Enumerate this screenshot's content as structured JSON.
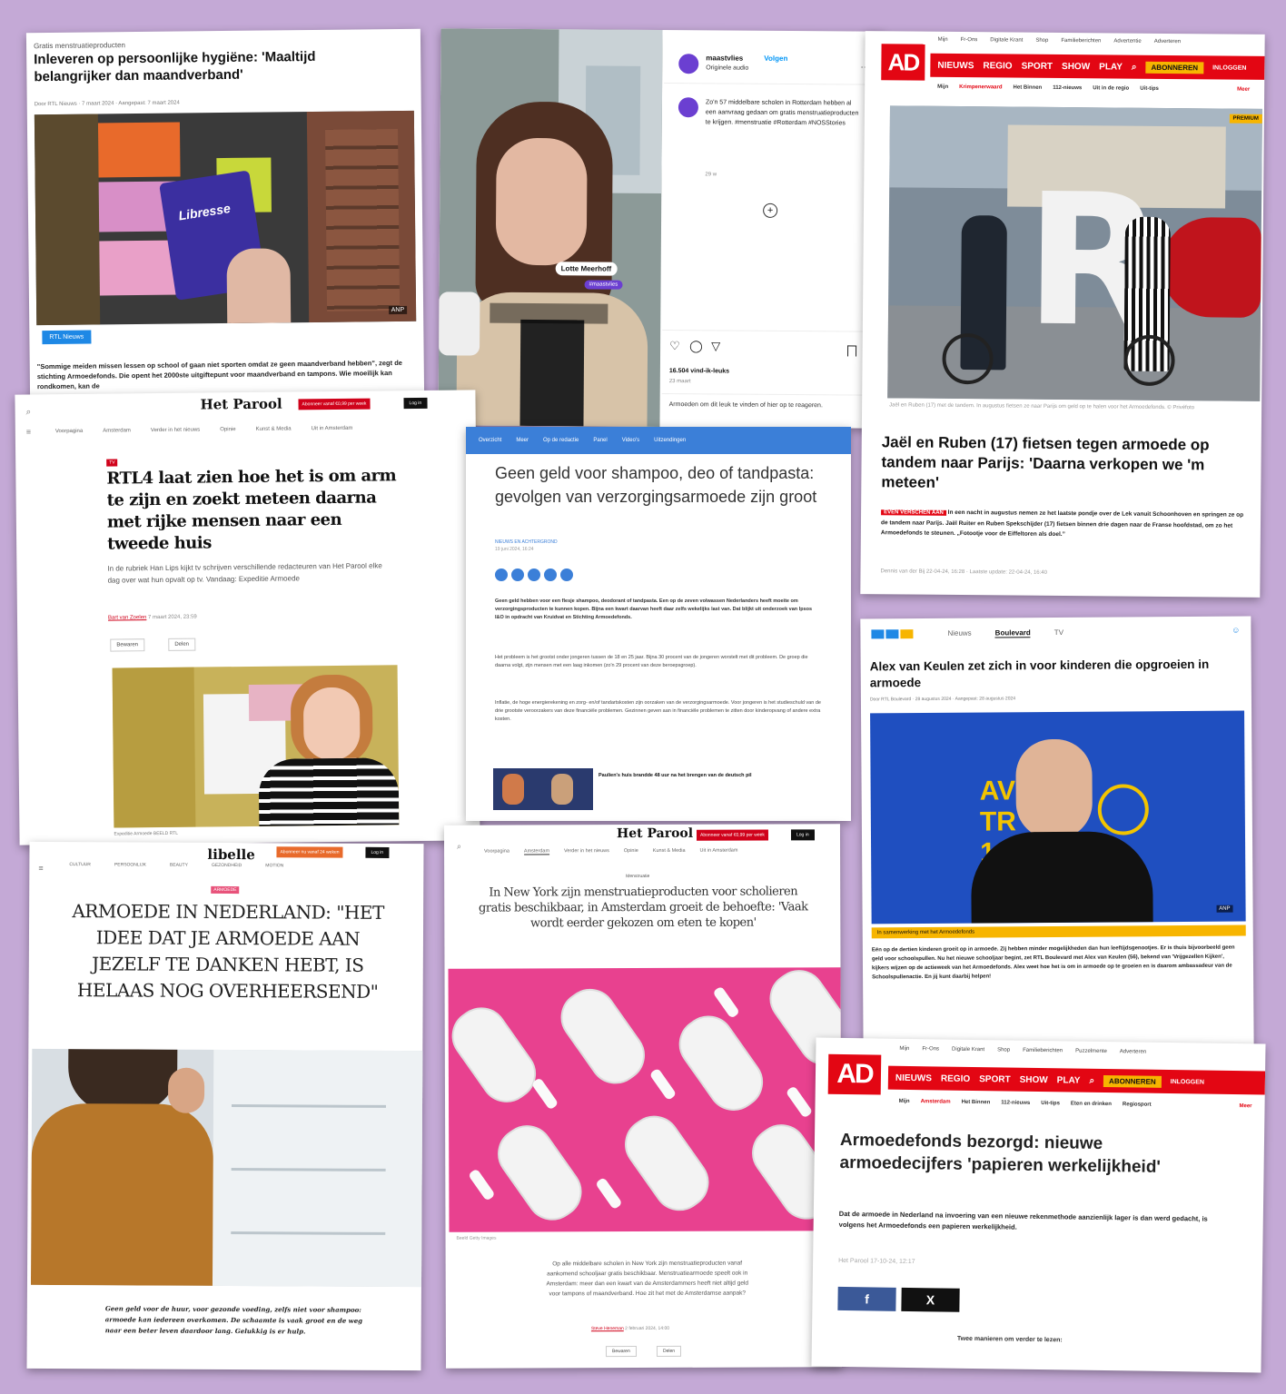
{
  "card1": {
    "kicker": "Gratis menstruatieproducten",
    "title": "Inleveren op persoonlijke hygiëne: 'Maaltijd belangrijker dan maandverband'",
    "byline": "Door RTL Nieuws · 7 maart 2024 · Aangepast: 7 maart 2024",
    "badge": "RTL Nieuws",
    "package_brand": "Libresse",
    "photo_credit": "ANP",
    "lead": "\"Sommige meiden missen lessen op school of gaan niet sporten omdat ze geen maandverband hebben\", zegt de stichting Armoedefonds. Die opent het 2000ste uitgiftepunt voor maandverband en tampons. Wie moeilijk kan rondkomen, kan de"
  },
  "card2": {
    "account": "maastvlies",
    "follow": "Volgen",
    "audio": "Originele audio",
    "caption": "Zo'n 57 middelbare scholen in Rotterdam hebben al een aanvraag gedaan om gratis menstruatieproducten te krijgen. #menstruatie #Rotterdam #NOSStories",
    "age": "29 w",
    "name_tag": "Lotte Meerhoff",
    "sub_tag": "#maastvlies",
    "likes": "16.504 vind-ik-leuks",
    "days": "23 maart",
    "reply": "Armoeden om dit leuk te vinden of hier op te reageren."
  },
  "card3": {
    "top_links": [
      "Mijn",
      "Fr-Ons",
      "Digitale Krant",
      "Shop",
      "Familieberichten",
      "Advertentie",
      "Adverteren"
    ],
    "logo": "AD",
    "nav": [
      "NIEUWS",
      "REGIO",
      "SPORT",
      "SHOW",
      "PLAY"
    ],
    "subscribe": "ABONNEREN",
    "login": "INLOGGEN",
    "subnav": [
      "Mijn",
      "Krimpenerwaard",
      "Het Binnen",
      "112-nieuws",
      "Uit in de regio",
      "Uit-tips"
    ],
    "more": "Meer",
    "premium": "PREMIUM",
    "caption": "Jaël en Ruben (17) met de tandem. In augustus fietsen ze naar Parijs om geld op te halen voor het Armoedefonds. © Privéfoto",
    "title": "Jaël en Ruben (17) fietsen tegen armoede op tandem naar Parijs: 'Daarna verkopen we 'm meteen'",
    "label": "EVEN VERSCHEN AAN",
    "lead": "In een nacht in augustus nemen ze het laatste pondje over de Lek vanuit Schoonhoven en springen ze op de tandem naar Parijs. Jaël Ruiter en Ruben Spekschijder (17) fietsen binnen drie dagen naar de Franse hoofdstad, om zo het Armoedefonds te steunen. „Fotootje voor de Eiffeltoren als doel.”",
    "meta": "Dennis van der Bij 22-04-24, 16:28 · Laatste update: 22-04-24, 16:40"
  },
  "card4": {
    "logo": "Het Parool",
    "cta": "Abonneer vanaf €0,99 per week",
    "login": "Log in",
    "nav": [
      "Voorpagina",
      "Amsterdam",
      "Verder in het nieuws",
      "Opinie",
      "Kunst & Media",
      "Uit in Amsterdam"
    ],
    "tag": "TV",
    "title": "RTL4 laat zien hoe het is om arm te zijn en zoekt meteen daarna met rijke mensen naar een tweede huis",
    "intro": "In de rubriek Han Lips kijkt tv schrijven verschillende redacteuren van Het Parool elke dag over wat hun opvalt op tv. Vandaag: Expeditie Armoede",
    "author": "Bart van Zoelen",
    "date": "7 maart 2024, 23:59",
    "save": "Bewaren",
    "share": "Delen",
    "img_caption": "Expeditie Armoede  BEELD RTL"
  },
  "card5": {
    "nav": [
      "Overzicht",
      "Meer",
      "Op de redactie",
      "Panel",
      "Video's",
      "Uitzendingen"
    ],
    "title": "Geen geld voor shampoo, deo of tandpasta: gevolgen van verzorgingsarmoede zijn groot",
    "author": "NIEUWS EN ACHTERGROND",
    "date": "19 juni 2024, 16:24",
    "p1": "Geen geld hebben voor een flesje shampoo, deodorant of tandpasta. Een op de zeven volwassen Nederlanders heeft moeite om verzorgingsproducten te kunnen kopen. Bijna een kwart daarvan heeft daar zelfs wekelijks last van. Dat blijkt uit onderzoek van Ipsos I&O in opdracht van Kruidvat en Stichting Armoedefonds.",
    "p2": "Het probleem is het grootst onder jongeren tussen de 18 en 25 jaar. Bijna 30 procent van de jongeren worstelt met dit probleem. De groep die daarna volgt, zijn mensen met een laag inkomen (zo'n 29 procent van deze beroepsgroep).",
    "p3": "Inflatie, de hoge energierekening en zorg- en/of tandartskosten zijn oorzaken van de verzorgingsarmoede. Voor jongeren is het studieschuld van de drie grootste veroorzakers van deze financiële problemen. Gezinnen geven aan in financiële problemen te zitten door kinderopvang of andere extra kosten.",
    "related": "Paulien's huis brandde 48 uur na het brengen van de deutsch pil"
  },
  "card6": {
    "tabs": [
      "Nieuws",
      "Boulevard",
      "TV"
    ],
    "title": "Alex van Keulen zet zich in voor kinderen die opgroeien in armoede",
    "byline": "Door RTL Boulevard · 28 augustus 2024 · Aangepast: 28 augustus 2024",
    "photo_credit": "ANP",
    "badge": "In samenwerking met het Armoedefonds",
    "lead": "Eén op de dertien kinderen groeit op in armoede. Zij hebben minder mogelijkheden dan hun leeftijdsgenootjes. Er is thuis bijvoorbeeld geen geld voor schoolspullen. Nu het nieuwe schooljaar begint, zet RTL Boulevard met Alex van Keulen (56), bekend van 'Vrijgezellen Kijken', kijkers wijzen op de actieweek van het Armoedefonds. Alex weet hoe het is om in armoede op te groeien en is daarom ambassadeur van de Schoolspullenactie. En jij kunt daarbij helpen!",
    "backdrop": "AV TR 10"
  },
  "card7": {
    "logo": "libelle",
    "cta": "Abonneer nu vanaf 24 weken",
    "login": "Log in",
    "nav": [
      "CULTUUR",
      "PERSOONLIJK",
      "BEAUTY",
      "GEZONDHEID",
      "MOTION"
    ],
    "tag": "ARMOEDE",
    "title": "ARMOEDE IN NEDERLAND: \"HET IDEE DAT JE ARMOEDE AAN JEZELF TE DANKEN HEBT, IS HELAAS NOG OVERHEERSEND\"",
    "lead": "Geen geld voor de huur, voor gezonde voeding, zelfs niet voor shampoo: armoede kan iedereen overkomen. De schaamte is vaak groot en de weg naar een beter leven daardoor lang. Gelukkig is er hulp."
  },
  "card8": {
    "logo": "Het Parool",
    "cta": "Abonneer vanaf €0,99 per week",
    "login": "Log in",
    "nav": [
      "Voorpagina",
      "Amsterdam",
      "Verder in het nieuws",
      "Opinie",
      "Kunst & Media",
      "Uit in Amsterdam"
    ],
    "tag": "Menstruatie",
    "title": "In New York zijn menstruatieproducten voor scholieren gratis beschikbaar, in Amsterdam groeit de behoefte: 'Vaak wordt eerder gekozen om eten te kopen'",
    "img_caption": "Beeld Getty Images",
    "lead": "Op alle middelbare scholen in New York zijn menstruatieproducten vanaf aankomend schooljaar gratis beschikbaar. Menstruatiearmoede speelt ook in Amsterdam: meer dan een kwart van de Amsterdammers heeft niet altijd geld voor tampons of maandverband. Hoe zit het met de Amsterdamse aanpak?",
    "author": "Steve Heneman",
    "date": "2 februari 2024, 14:00",
    "save": "Bewaren",
    "share": "Delen"
  },
  "card9": {
    "top_links": [
      "Mijn",
      "Fr-Ons",
      "Digitale Krant",
      "Shop",
      "Familieberichten",
      "Puzzelmente",
      "Adverteren"
    ],
    "logo": "AD",
    "nav": [
      "NIEUWS",
      "REGIO",
      "SPORT",
      "SHOW",
      "PLAY"
    ],
    "subscribe": "ABONNEREN",
    "login": "INLOGGEN",
    "subnav": [
      "Mijn",
      "Amsterdam",
      "Het Binnen",
      "112-nieuws",
      "Uit-tips",
      "Eten en drinken",
      "Regiosport"
    ],
    "more": "Meer",
    "title": "Armoedefonds bezorgd: nieuwe armoedecijfers 'papieren werkelijkheid'",
    "lead": "Dat de armoede in Nederland na invoering van een nieuwe rekenmethode aanzienlijk lager is dan werd gedacht, is volgens het Armoedefonds een papieren werkelijkheid.",
    "meta": "Het Parool 17-10-24, 12:17",
    "fb": "f",
    "x": "X",
    "more_reading": "Twee manieren om verder te lezen:"
  },
  "colors": {
    "background": "#c4a9d6",
    "ad_red": "#e30613",
    "rtl_blue": "#1e88e5",
    "parool_red": "#d0021b",
    "pink": "#e8418f",
    "facebook": "#3b5998"
  }
}
